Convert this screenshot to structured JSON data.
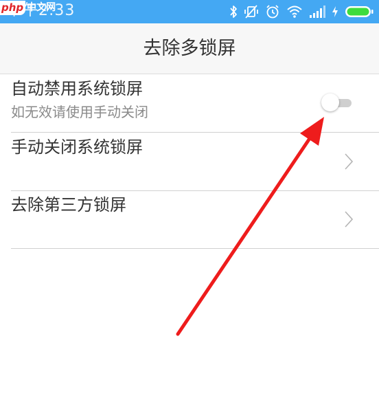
{
  "status_bar": {
    "time": "下午2:33",
    "watermark": {
      "php": "php",
      "cn": "中文网"
    },
    "icons": [
      "bluetooth-icon",
      "vibrate-off-icon",
      "alarm-icon",
      "wifi-icon",
      "signal-icon",
      "charging-icon",
      "battery-icon"
    ],
    "color": "#44a8f3",
    "battery_color": "#3ddc3d"
  },
  "header": {
    "title": "去除多锁屏"
  },
  "settings": {
    "items": [
      {
        "title": "自动禁用系统锁屏",
        "subtitle": "如无效请使用手动关闭",
        "control": "toggle",
        "toggle_on": false
      },
      {
        "title": "手动关闭系统锁屏",
        "control": "chevron-right-icon"
      },
      {
        "title": "去除第三方锁屏",
        "control": "chevron-right-icon"
      }
    ]
  },
  "annotation": {
    "arrow_color": "#ee1c1c"
  }
}
